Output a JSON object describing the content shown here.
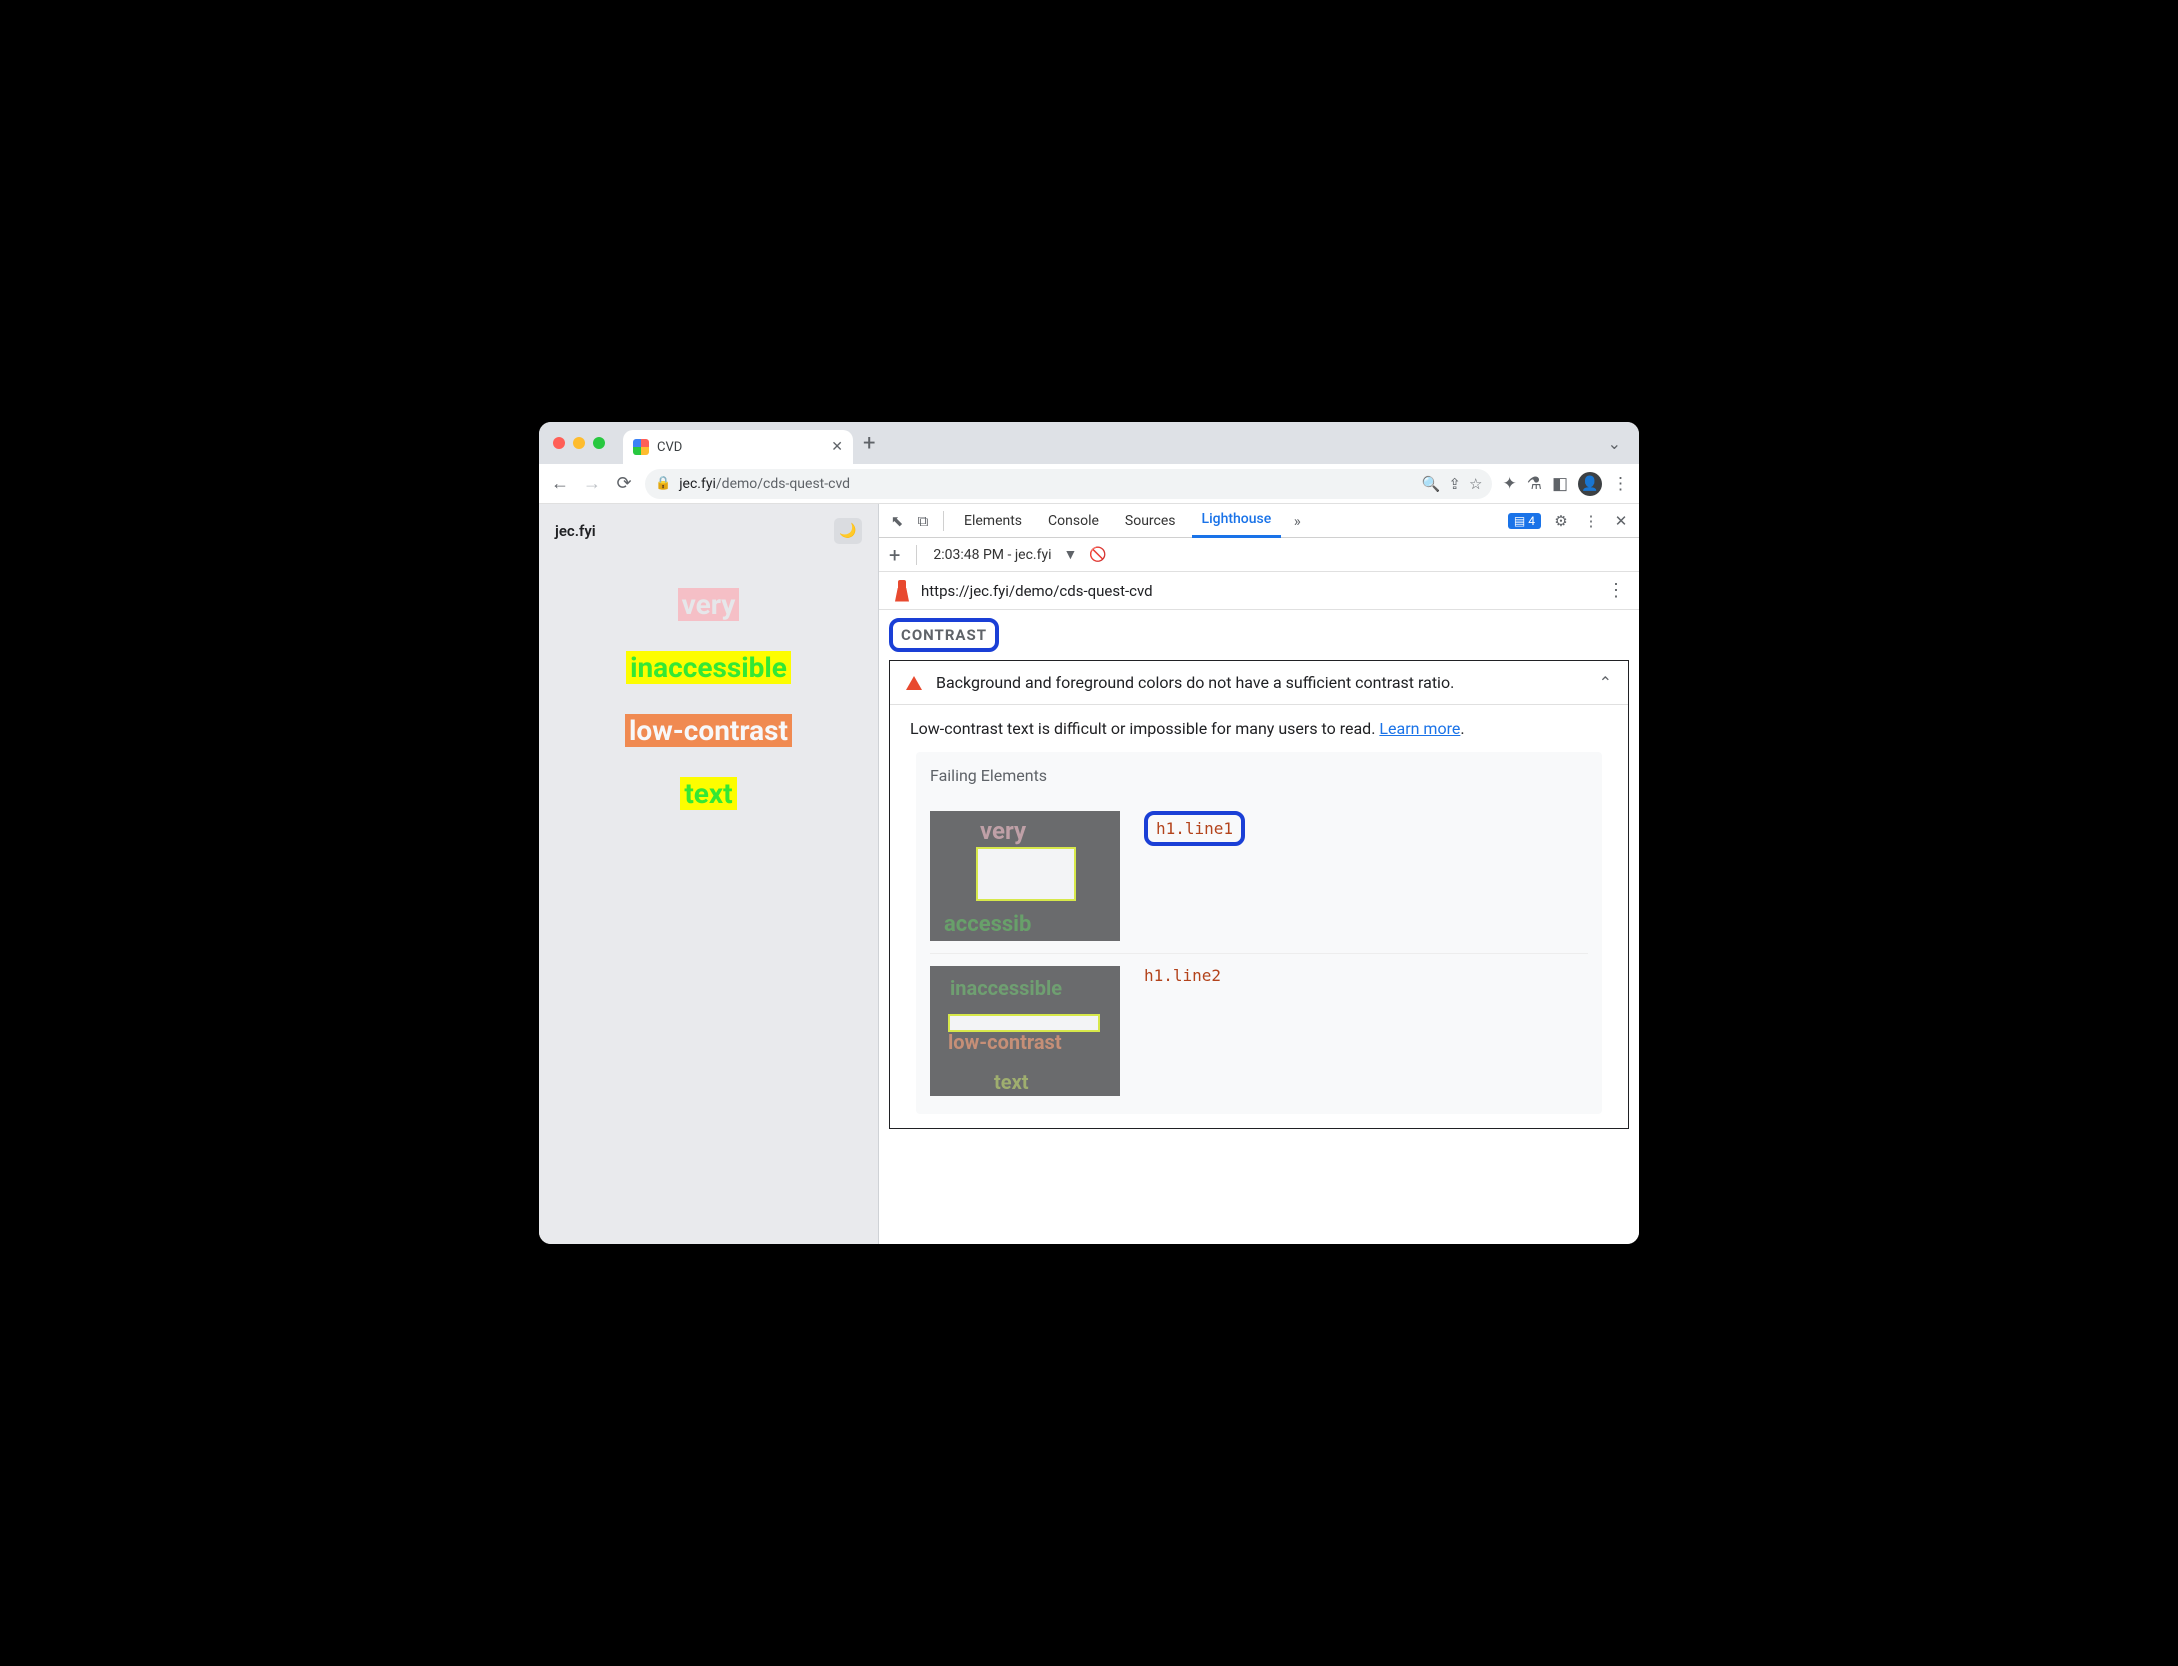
{
  "browser": {
    "tab_title": "CVD",
    "url_domain": "jec.fyi",
    "url_path": "/demo/cds-quest-cvd"
  },
  "page": {
    "site_title": "jec.fyi",
    "words": {
      "w1": "very",
      "w2": "inaccessible",
      "w3": "low-contrast",
      "w4": "text"
    }
  },
  "devtools": {
    "tabs": {
      "elements": "Elements",
      "console": "Console",
      "sources": "Sources",
      "lighthouse": "Lighthouse"
    },
    "messages_count": "4",
    "sub": {
      "run_label": "2:03:48 PM - jec.fyi"
    },
    "report_url": "https://jec.fyi/demo/cds-quest-cvd",
    "section_label": "CONTRAST",
    "audit": {
      "title": "Background and foreground colors do not have a sufficient contrast ratio.",
      "description": "Low-contrast text is difficult or impossible for many users to read. ",
      "learn_more": "Learn more",
      "period": ".",
      "failing_heading": "Failing Elements",
      "items": {
        "i1": "h1.line1",
        "i2": "h1.line2"
      }
    }
  },
  "thumb": {
    "t1a": "very",
    "t1b": "accessib",
    "t2a": "inaccessible",
    "t2b": "low-contrast",
    "t2c": "text"
  }
}
